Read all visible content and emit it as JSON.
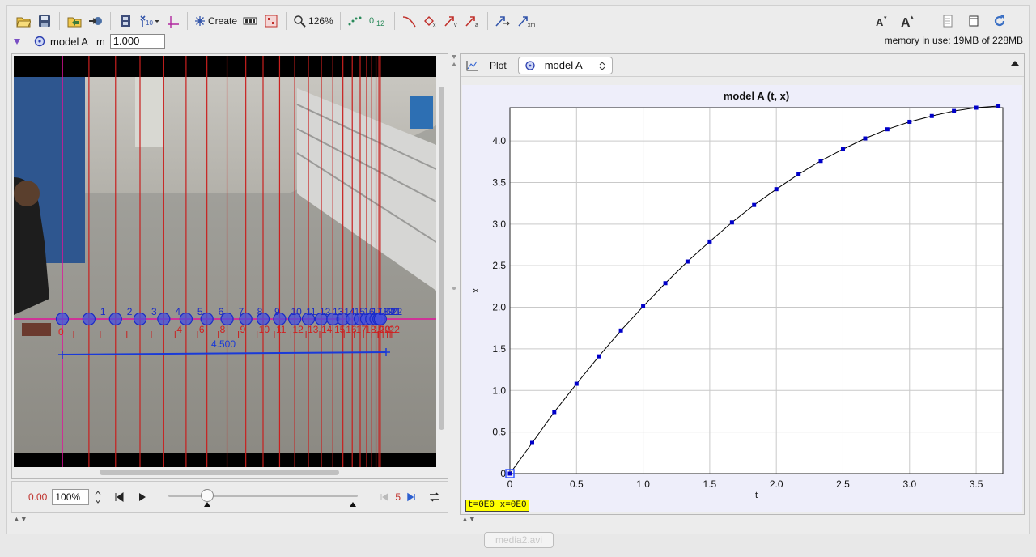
{
  "toolbar": {
    "create_label": "Create",
    "zoom_label": "126%",
    "sub_label": "0",
    "sub_index": "12"
  },
  "track": {
    "name": "model A",
    "mass_label": "m",
    "mass_value": "1.000"
  },
  "memory": "memory in use: 19MB of 228MB",
  "video": {
    "axis_label_top": [
      "1",
      "2",
      "3",
      "4",
      "5",
      "6",
      "7",
      "8",
      "9",
      "10",
      "11",
      "12",
      "13",
      "14",
      "15",
      "16",
      "17",
      "18",
      "19",
      "20",
      "21",
      "22"
    ],
    "axis_label_bottom": [
      "4",
      "6",
      "8",
      "9",
      "10",
      "11",
      "12",
      "13",
      "14",
      "15",
      "16",
      "17",
      "18",
      "19",
      "20",
      "21",
      "22"
    ],
    "tape_length": "4.500",
    "origin_label": "0"
  },
  "player": {
    "time": "0.00",
    "zoom": "100%",
    "frame": "5"
  },
  "plot": {
    "tab_label": "Plot",
    "track_select": "model A",
    "readout": "t=0E0  x=0E0"
  },
  "bottom_tab": "media2.avi",
  "chart_data": {
    "type": "scatter",
    "title": "model A (t, x)",
    "xlabel": "t",
    "ylabel": "x",
    "xlim": [
      0,
      3.7
    ],
    "ylim": [
      0,
      4.4
    ],
    "xticks": [
      0,
      0.5,
      1.0,
      1.5,
      2.0,
      2.5,
      3.0,
      3.5
    ],
    "yticks": [
      0,
      0.5,
      1.0,
      1.5,
      2.0,
      2.5,
      3.0,
      3.5,
      4.0
    ],
    "grid": true,
    "series": [
      {
        "color": "#0000c8",
        "x": [
          0,
          0.167,
          0.333,
          0.5,
          0.667,
          0.833,
          1.0,
          1.167,
          1.333,
          1.5,
          1.667,
          1.833,
          2.0,
          2.167,
          2.333,
          2.5,
          2.667,
          2.833,
          3.0,
          3.167,
          3.333,
          3.5,
          3.667
        ],
        "y": [
          0,
          0.37,
          0.74,
          1.08,
          1.41,
          1.72,
          2.01,
          2.29,
          2.55,
          2.79,
          3.02,
          3.23,
          3.42,
          3.6,
          3.76,
          3.9,
          4.03,
          4.14,
          4.23,
          4.3,
          4.36,
          4.4,
          4.42
        ]
      }
    ]
  }
}
